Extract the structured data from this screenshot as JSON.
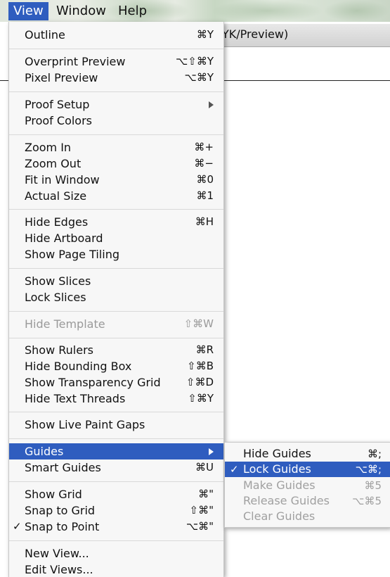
{
  "menubar": {
    "items": [
      {
        "label": "View"
      },
      {
        "label": "Window"
      },
      {
        "label": "Help"
      }
    ]
  },
  "document": {
    "title_fragment": "YK/Preview)"
  },
  "view_menu": {
    "items": [
      {
        "label": "Outline",
        "shortcut": "⌘Y"
      },
      {
        "label": "Overprint Preview",
        "shortcut": "⌥⇧⌘Y"
      },
      {
        "label": "Pixel Preview",
        "shortcut": "⌥⌘Y"
      },
      {
        "label": "Proof Setup",
        "shortcut": ""
      },
      {
        "label": "Proof Colors",
        "shortcut": ""
      },
      {
        "label": "Zoom In",
        "shortcut": "⌘+"
      },
      {
        "label": "Zoom Out",
        "shortcut": "⌘−"
      },
      {
        "label": "Fit in Window",
        "shortcut": "⌘0"
      },
      {
        "label": "Actual Size",
        "shortcut": "⌘1"
      },
      {
        "label": "Hide Edges",
        "shortcut": "⌘H"
      },
      {
        "label": "Hide Artboard",
        "shortcut": ""
      },
      {
        "label": "Show Page Tiling",
        "shortcut": ""
      },
      {
        "label": "Show Slices",
        "shortcut": ""
      },
      {
        "label": "Lock Slices",
        "shortcut": ""
      },
      {
        "label": "Hide Template",
        "shortcut": "⇧⌘W"
      },
      {
        "label": "Show Rulers",
        "shortcut": "⌘R"
      },
      {
        "label": "Hide Bounding Box",
        "shortcut": "⇧⌘B"
      },
      {
        "label": "Show Transparency Grid",
        "shortcut": "⇧⌘D"
      },
      {
        "label": "Hide Text Threads",
        "shortcut": "⇧⌘Y"
      },
      {
        "label": "Show Live Paint Gaps",
        "shortcut": ""
      },
      {
        "label": "Guides",
        "shortcut": ""
      },
      {
        "label": "Smart Guides",
        "shortcut": "⌘U"
      },
      {
        "label": "Show Grid",
        "shortcut": "⌘\""
      },
      {
        "label": "Snap to Grid",
        "shortcut": "⇧⌘\""
      },
      {
        "label": "Snap to Point",
        "shortcut": "⌥⌘\"",
        "check": "✓"
      },
      {
        "label": "New View...",
        "shortcut": ""
      },
      {
        "label": "Edit Views...",
        "shortcut": ""
      }
    ]
  },
  "guides_submenu": {
    "items": [
      {
        "label": "Hide Guides",
        "shortcut": "⌘;"
      },
      {
        "label": "Lock Guides",
        "shortcut": "⌥⌘;",
        "check": "✓"
      },
      {
        "label": "Make Guides",
        "shortcut": "⌘5"
      },
      {
        "label": "Release Guides",
        "shortcut": "⌥⌘5"
      },
      {
        "label": "Clear Guides",
        "shortcut": ""
      }
    ]
  },
  "colors": {
    "highlight": "#2f5dbf",
    "menu_bg": "#f7f7f7",
    "disabled_text": "#9a9a9a"
  }
}
